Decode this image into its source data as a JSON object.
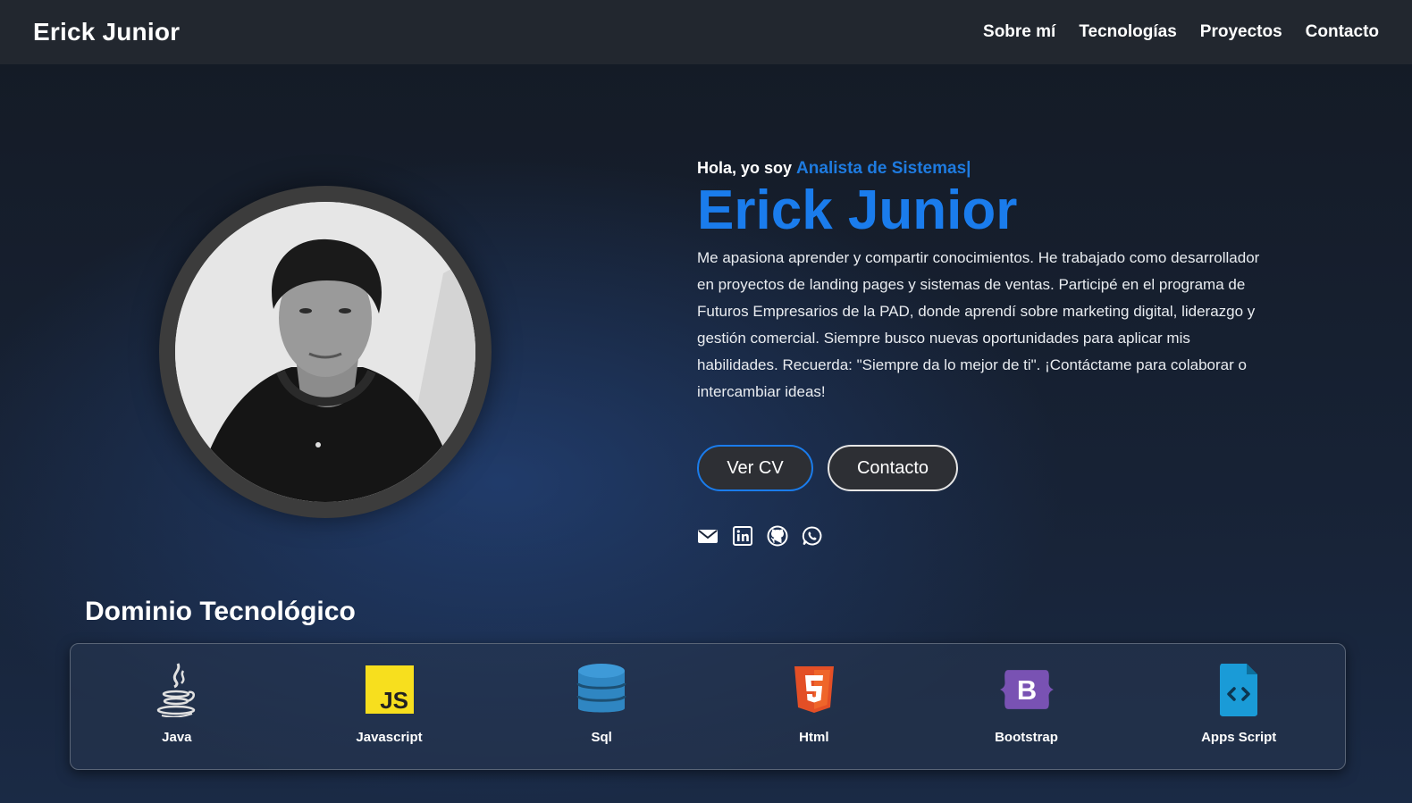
{
  "nav": {
    "brand": "Erick Junior",
    "links": [
      "Sobre mí",
      "Tecnologías",
      "Proyectos",
      "Contacto"
    ]
  },
  "hero": {
    "greeting": "Hola, yo soy",
    "role": "Analista de Sistemas|",
    "name": "Erick Junior",
    "about": "Me apasiona aprender y compartir conocimientos. He trabajado como desarrollador en proyectos de landing pages y sistemas de ventas. Participé en el programa de Futuros Empresarios de la PAD, donde aprendí sobre marketing digital, liderazgo y gestión comercial. Siempre busco nuevas oportunidades para aplicar mis habilidades. Recuerda: \"Siempre da lo mejor de ti\". ¡Contáctame para colaborar o intercambiar ideas!",
    "buttons": {
      "cv": "Ver CV",
      "contact": "Contacto"
    },
    "socials": [
      "envelope-icon",
      "linkedin-icon",
      "github-icon",
      "whatsapp-icon"
    ]
  },
  "tech": {
    "title": "Dominio Tecnológico",
    "items": [
      {
        "label": "Java",
        "icon": "java-icon"
      },
      {
        "label": "Javascript",
        "icon": "javascript-icon"
      },
      {
        "label": "Sql",
        "icon": "database-icon"
      },
      {
        "label": "Html",
        "icon": "html5-icon"
      },
      {
        "label": "Bootstrap",
        "icon": "bootstrap-icon"
      },
      {
        "label": "Apps Script",
        "icon": "apps-script-icon"
      }
    ]
  },
  "colors": {
    "accent": "#1a7cec",
    "nav_bg": "#22272f",
    "button_bg": "#2d2f34"
  }
}
